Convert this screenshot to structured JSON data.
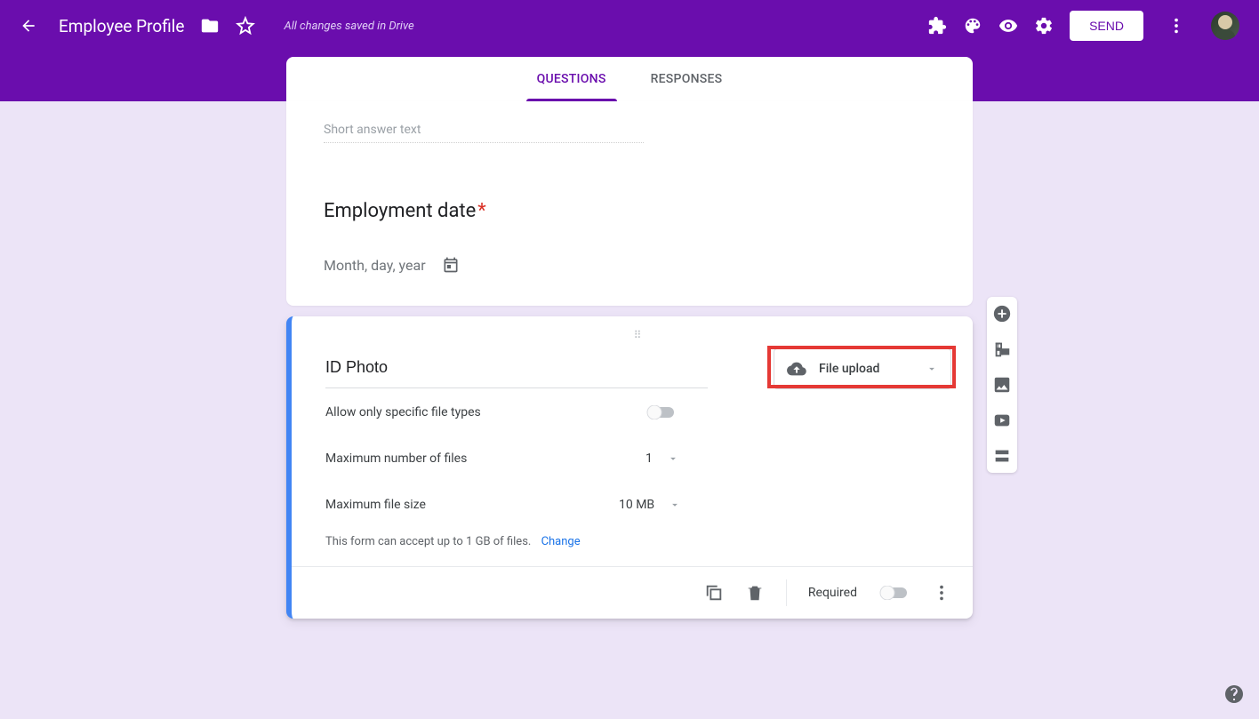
{
  "header": {
    "title": "Employee Profile",
    "save_status": "All changes saved in Drive",
    "send_label": "SEND"
  },
  "tabs": {
    "questions": "QUESTIONS",
    "responses": "RESPONSES"
  },
  "prev_card": {
    "short_answer_placeholder": "Short answer text",
    "question_title": "Employment date",
    "date_placeholder": "Month, day, year"
  },
  "active_card": {
    "question_title": "ID Photo",
    "type_label": "File upload",
    "allow_types_label": "Allow only specific file types",
    "max_files_label": "Maximum number of files",
    "max_files_value": "1",
    "max_size_label": "Maximum file size",
    "max_size_value": "10 MB",
    "limit_note": "This form can accept up to 1 GB of files.",
    "change_link": "Change",
    "required_label": "Required"
  },
  "icons": {
    "back": "arrow-back",
    "folder": "folder",
    "star": "star",
    "addons": "puzzle",
    "theme": "palette",
    "preview": "eye",
    "settings": "gear",
    "more": "more-vert",
    "calendar": "calendar",
    "copy": "copy",
    "delete": "trash",
    "add_question": "plus-circle",
    "add_title": "title",
    "add_image": "image",
    "add_video": "video",
    "add_section": "section",
    "help": "help"
  }
}
